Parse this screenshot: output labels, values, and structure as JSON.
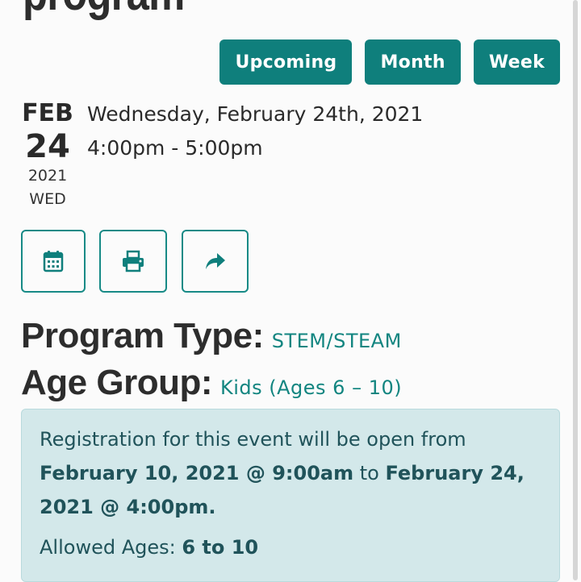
{
  "page": {
    "title": "program"
  },
  "view_switch": {
    "upcoming": "Upcoming",
    "month": "Month",
    "week": "Week"
  },
  "event": {
    "month": "FEB",
    "day": "24",
    "year": "2021",
    "weekday": "WED",
    "full_date": "Wednesday, February 24th, 2021",
    "time": "4:00pm - 5:00pm"
  },
  "actions": [
    {
      "icon": "calendar-icon"
    },
    {
      "icon": "print-icon"
    },
    {
      "icon": "share-icon"
    }
  ],
  "details": {
    "program_type_label": "Program Type:",
    "program_type_value": "STEM/STEAM",
    "age_group_label": "Age Group:",
    "age_group_value": "Kids (Ages 6 – 10)"
  },
  "registration": {
    "intro": "Registration for this event will be open from",
    "open_datetime": "February 10, 2021 @ 9:00am",
    "connector": "to",
    "close_datetime": "February 24, 2021 @ 4:00pm",
    "end_punct": ".",
    "ages_label": "Allowed Ages:",
    "ages_value": "6 to 10"
  },
  "colors": {
    "accent": "#0f7f7c",
    "accent_text": "#128580",
    "notice_bg": "#d3e8ea",
    "notice_text": "#20535a"
  }
}
